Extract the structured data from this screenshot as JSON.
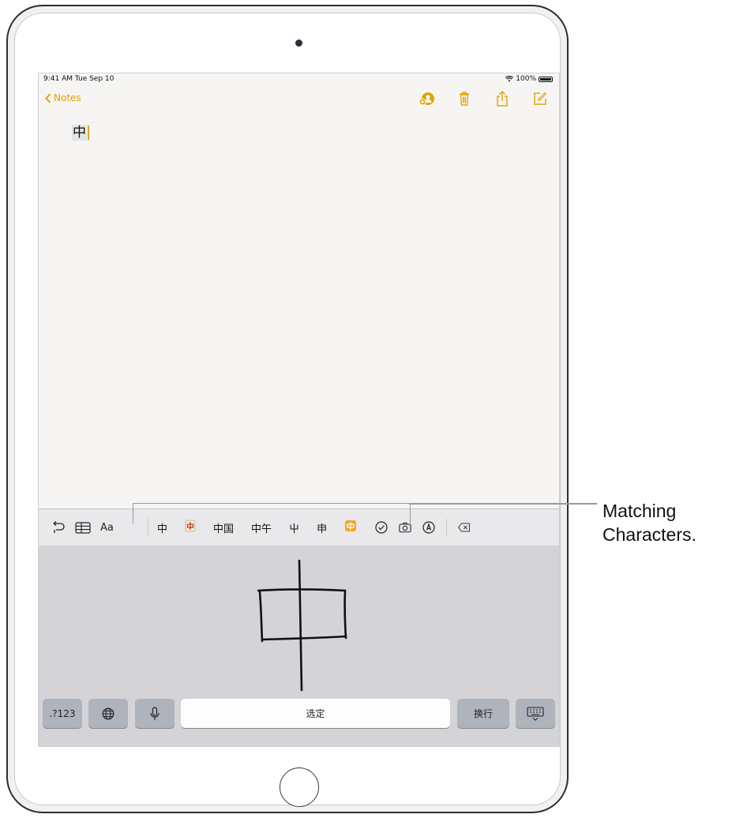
{
  "status_bar": {
    "time": "9:41 AM  Tue Sep 10",
    "battery": "100%"
  },
  "nav": {
    "back_label": "Notes",
    "actions": [
      "add-people-icon",
      "trash-icon",
      "share-icon",
      "compose-icon"
    ]
  },
  "note": {
    "text": "中"
  },
  "keyboard": {
    "tools": [
      "undo-icon",
      "table-icon",
      "Aa"
    ],
    "tools_text": "Aa",
    "candidates": [
      "中",
      "中",
      "中国",
      "中午",
      "屮",
      "申",
      "中"
    ],
    "right_tools": [
      "checklist-icon",
      "camera-icon",
      "markup-icon",
      "delete-icon"
    ],
    "keys": {
      "numbers": ".?123",
      "globe": "globe-icon",
      "mic": "mic-icon",
      "select": "选定",
      "return": "换行",
      "hide": "keyboard-hide-icon"
    },
    "handwriting_char": "中"
  },
  "callout": {
    "line1": "Matching",
    "line2": "Characters."
  },
  "colors": {
    "accent": "#e1a400",
    "keyboard_bg": "#d4d4d8",
    "key_gray": "#aeb3bc"
  }
}
